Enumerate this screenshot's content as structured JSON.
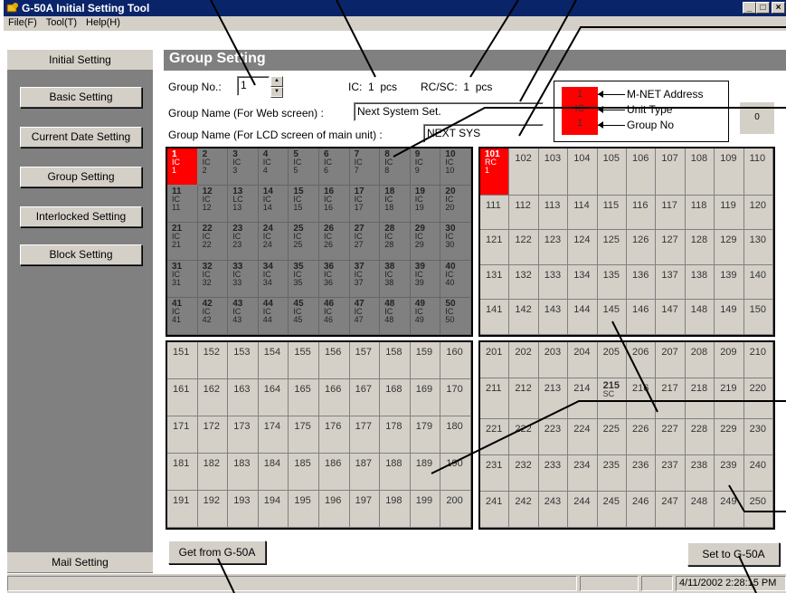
{
  "window": {
    "title": "G-50A Initial Setting Tool",
    "minimize": "_",
    "maximize": "□",
    "close": "×"
  },
  "menu": [
    "File(F)",
    "Tool(T)",
    "Help(H)"
  ],
  "sidebar": {
    "header": "Initial Setting",
    "items": [
      {
        "label": "Basic Setting"
      },
      {
        "label": "Current Date Setting"
      },
      {
        "label": "Group Setting"
      },
      {
        "label": "Interlocked Setting"
      },
      {
        "label": "Block Setting"
      }
    ],
    "footer": "Mail Setting"
  },
  "main": {
    "title": "Group Setting",
    "group_no_label": "Group No.:",
    "group_no_value": "1",
    "ic_label": "IC:",
    "ic_count": "1",
    "ic_unit": "pcs",
    "rcsc_label": "RC/SC:",
    "rcsc_count": "1",
    "rcsc_unit": "pcs",
    "web_name_label": "Group Name (For Web screen) :",
    "web_name_value": "Next System Set.",
    "lcd_name_label": "Group Name (For LCD screen of main unit) :",
    "lcd_name_value": "NEXT SYS",
    "zero_box": "0"
  },
  "legend": {
    "cell_address": "1",
    "cell_type": "IC",
    "cell_group": "1",
    "address_label": "M-NET Address",
    "type_label": "Unit Type",
    "group_label": "Group No"
  },
  "grid_ic": [
    {
      "n": "1",
      "t": "IC",
      "g": "1",
      "red": true
    },
    {
      "n": "2",
      "t": "IC",
      "g": "2"
    },
    {
      "n": "3",
      "t": "IC",
      "g": "3"
    },
    {
      "n": "4",
      "t": "IC",
      "g": "4"
    },
    {
      "n": "5",
      "t": "IC",
      "g": "5"
    },
    {
      "n": "6",
      "t": "IC",
      "g": "6"
    },
    {
      "n": "7",
      "t": "IC",
      "g": "7"
    },
    {
      "n": "8",
      "t": "IC",
      "g": "8"
    },
    {
      "n": "9",
      "t": "IC",
      "g": "9"
    },
    {
      "n": "10",
      "t": "IC",
      "g": "10"
    },
    {
      "n": "11",
      "t": "IC",
      "g": "11"
    },
    {
      "n": "12",
      "t": "IC",
      "g": "12"
    },
    {
      "n": "13",
      "t": "LC",
      "g": "13"
    },
    {
      "n": "14",
      "t": "IC",
      "g": "14"
    },
    {
      "n": "15",
      "t": "IC",
      "g": "15"
    },
    {
      "n": "16",
      "t": "IC",
      "g": "16"
    },
    {
      "n": "17",
      "t": "IC",
      "g": "17"
    },
    {
      "n": "18",
      "t": "IC",
      "g": "18"
    },
    {
      "n": "19",
      "t": "IC",
      "g": "19"
    },
    {
      "n": "20",
      "t": "IC",
      "g": "20"
    },
    {
      "n": "21",
      "t": "IC",
      "g": "21"
    },
    {
      "n": "22",
      "t": "IC",
      "g": "22"
    },
    {
      "n": "23",
      "t": "IC",
      "g": "23"
    },
    {
      "n": "24",
      "t": "IC",
      "g": "24"
    },
    {
      "n": "25",
      "t": "IC",
      "g": "25"
    },
    {
      "n": "26",
      "t": "IC",
      "g": "26"
    },
    {
      "n": "27",
      "t": "IC",
      "g": "27"
    },
    {
      "n": "28",
      "t": "IC",
      "g": "28"
    },
    {
      "n": "29",
      "t": "IC",
      "g": "29"
    },
    {
      "n": "30",
      "t": "IC",
      "g": "30"
    },
    {
      "n": "31",
      "t": "IC",
      "g": "31"
    },
    {
      "n": "32",
      "t": "IC",
      "g": "32"
    },
    {
      "n": "33",
      "t": "IC",
      "g": "33"
    },
    {
      "n": "34",
      "t": "IC",
      "g": "34"
    },
    {
      "n": "35",
      "t": "IC",
      "g": "35"
    },
    {
      "n": "36",
      "t": "IC",
      "g": "36"
    },
    {
      "n": "37",
      "t": "IC",
      "g": "37"
    },
    {
      "n": "38",
      "t": "IC",
      "g": "38"
    },
    {
      "n": "39",
      "t": "IC",
      "g": "39"
    },
    {
      "n": "40",
      "t": "IC",
      "g": "40"
    },
    {
      "n": "41",
      "t": "IC",
      "g": "41"
    },
    {
      "n": "42",
      "t": "IC",
      "g": "42"
    },
    {
      "n": "43",
      "t": "IC",
      "g": "43"
    },
    {
      "n": "44",
      "t": "IC",
      "g": "44"
    },
    {
      "n": "45",
      "t": "IC",
      "g": "45"
    },
    {
      "n": "46",
      "t": "IC",
      "g": "46"
    },
    {
      "n": "47",
      "t": "IC",
      "g": "47"
    },
    {
      "n": "48",
      "t": "IC",
      "g": "48"
    },
    {
      "n": "49",
      "t": "IC",
      "g": "49"
    },
    {
      "n": "50",
      "t": "IC",
      "g": "50"
    }
  ],
  "grid_rc_first_cell": {
    "n": "101",
    "t": "RC",
    "g": "1"
  },
  "grid_rc_start": 102,
  "grid_bl_start": 151,
  "grid_br_start": 201,
  "grid_br_special": {
    "n": "215",
    "t": "SC"
  },
  "buttons": {
    "get": "Get from G-50A",
    "set": "Set to G-50A"
  },
  "status": {
    "datetime": "4/11/2002 2:28:15 PM"
  },
  "colors": {
    "selected": "#ff0000",
    "assigned": "#808080",
    "title_bar": "#0a246a",
    "face": "#d4d0c8"
  }
}
